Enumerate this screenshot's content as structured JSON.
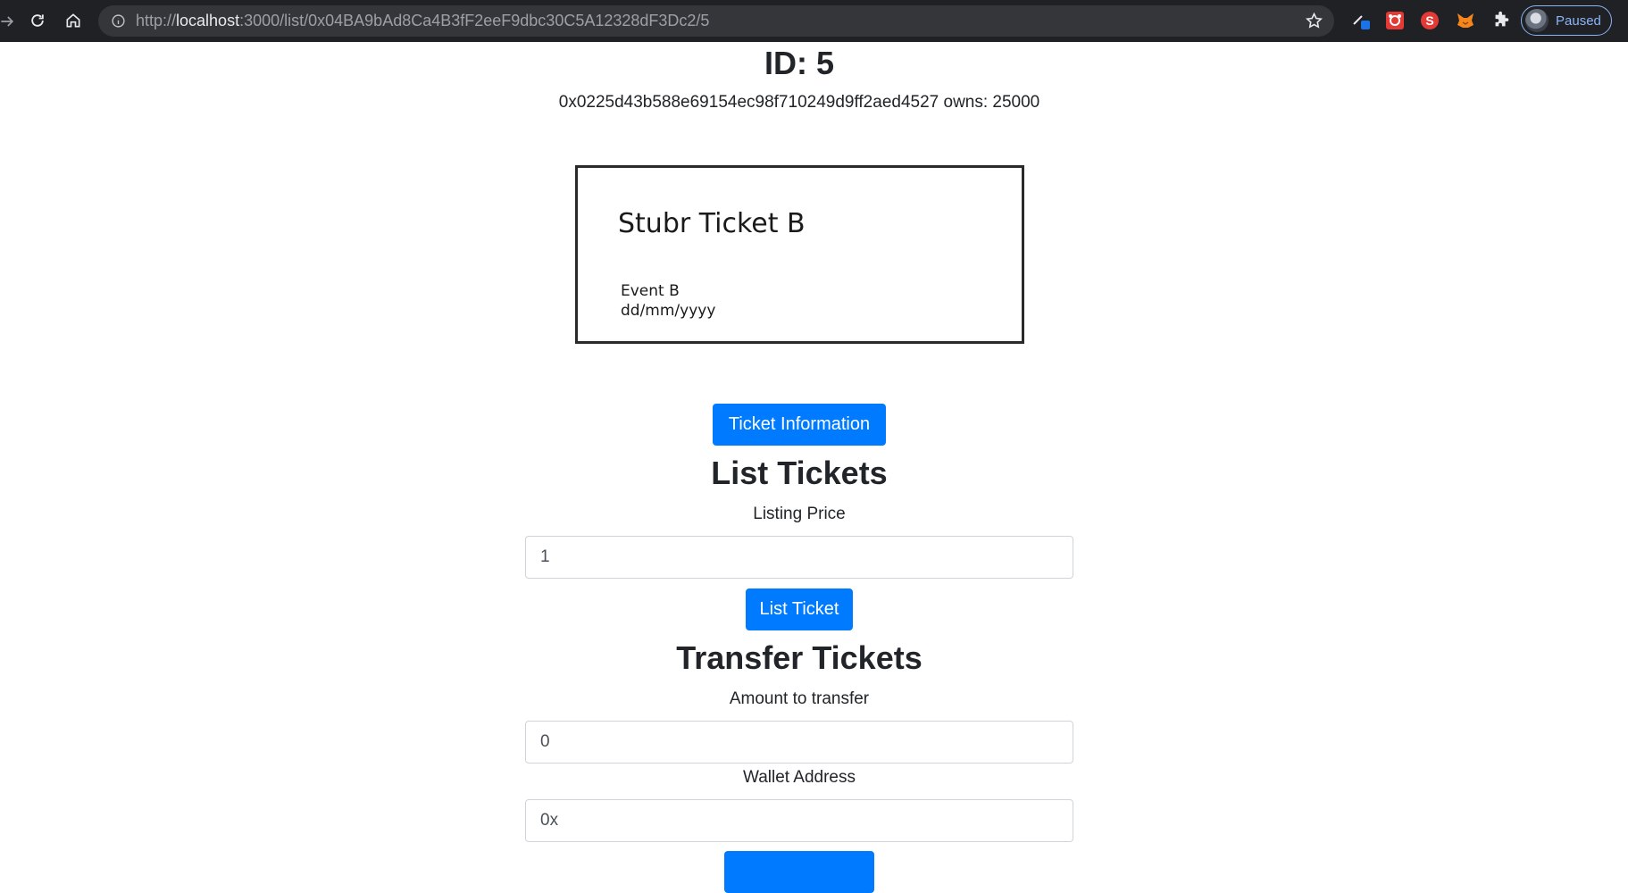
{
  "browser": {
    "url_prefix": "http://",
    "url_host": "localhost",
    "url_rest": ":3000/list/0x04BA9bAd8Ca4B3fF2eeF9dbc30C5A12328dF3Dc2/5",
    "profile_status": "Paused",
    "extension_s_letter": "S"
  },
  "page": {
    "id_title": "ID: 5",
    "owner_line": "0x0225d43b588e69154ec98f710249d9ff2aed4527 owns: 25000",
    "ticket": {
      "name": "Stubr Ticket B",
      "event": "Event B",
      "date": "dd/mm/yyyy"
    },
    "ticket_info_button": "Ticket Information",
    "list_section": {
      "title": "List Tickets",
      "price_label": "Listing Price",
      "price_value": "1",
      "submit_label": "List Ticket"
    },
    "transfer_section": {
      "title": "Transfer Tickets",
      "amount_label": "Amount to transfer",
      "amount_value": "0",
      "wallet_label": "Wallet Address",
      "wallet_value": "0x"
    }
  },
  "colors": {
    "primary": "#007bff",
    "chrome_bg": "#202124",
    "omnibox_bg": "#35363a",
    "profile_accent": "#8ab4f8"
  }
}
